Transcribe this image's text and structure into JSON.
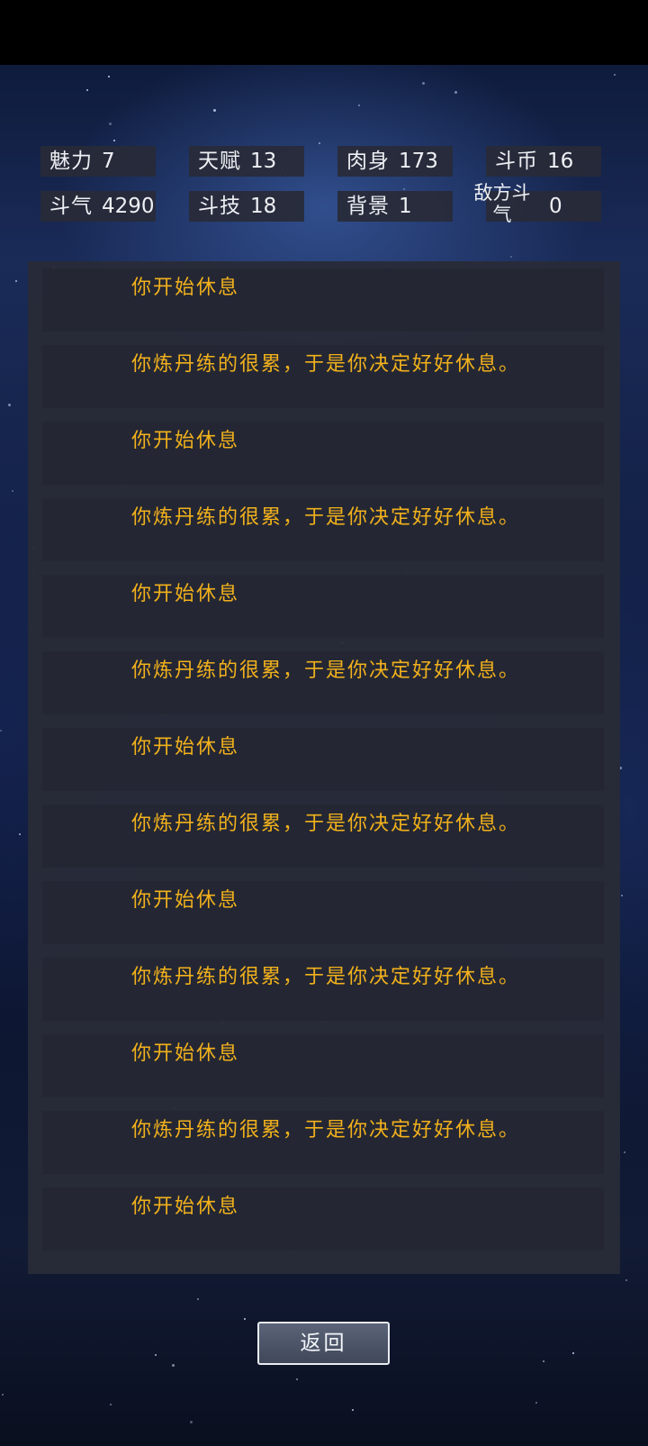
{
  "stats": [
    {
      "label": "魅力",
      "value": "7"
    },
    {
      "label": "天赋",
      "value": "13"
    },
    {
      "label": "肉身",
      "value": "173"
    },
    {
      "label": "斗币",
      "value": "16"
    },
    {
      "label": "斗气",
      "value": "4290"
    },
    {
      "label": "斗技",
      "value": "18"
    },
    {
      "label": "背景",
      "value": "1"
    },
    {
      "label": "敌方斗气",
      "value": "0"
    }
  ],
  "log": [
    "你开始休息",
    "你炼丹练的很累，于是你决定好好休息。",
    "你开始休息",
    "你炼丹练的很累，于是你决定好好休息。",
    "你开始休息",
    "你炼丹练的很累，于是你决定好好休息。",
    "你开始休息",
    "你炼丹练的很累，于是你决定好好休息。",
    "你开始休息",
    "你炼丹练的很累，于是你决定好好休息。",
    "你开始休息",
    "你炼丹练的很累，于是你决定好好休息。",
    "你开始休息"
  ],
  "back_button": {
    "label": "返回"
  },
  "colors": {
    "log_text": "#f2b11c",
    "panel_bg": "#282b38",
    "entry_bg": "#242733",
    "stat_bg": "#282a37"
  }
}
